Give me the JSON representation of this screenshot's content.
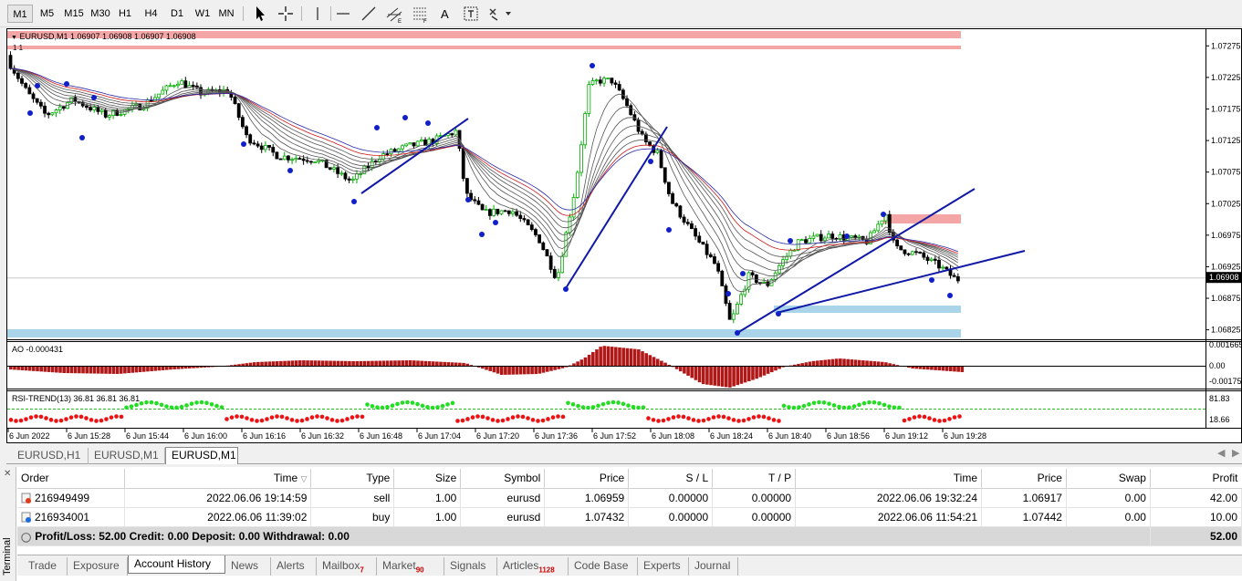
{
  "toolbar": {
    "timeframes": [
      "M1",
      "M5",
      "M15",
      "M30",
      "H1",
      "H4",
      "D1",
      "W1",
      "MN"
    ],
    "selected_timeframe": "M1",
    "tools": [
      "cursor-icon",
      "crosshair-icon",
      "vertical-line-icon",
      "horizontal-line-icon",
      "trend-line-icon",
      "equidistant-channel-icon",
      "fibonacci-icon",
      "text-icon",
      "text-label-icon",
      "shapes-icon"
    ],
    "text_tool_label": "A"
  },
  "chart": {
    "symbol_header": "EURUSD,M1  1.06907 1.06908 1.06907 1.06908",
    "sub_marker": "1   1",
    "price_ticks": [
      "1.07275",
      "1.07225",
      "1.07175",
      "1.07125",
      "1.07075",
      "1.07025",
      "1.06975",
      "1.06925",
      "1.06875",
      "1.06825"
    ],
    "current_price": "1.06908",
    "ao_label": "AO -0.000431",
    "ao_ticks": [
      "0.001665",
      "0.00",
      "-0.00175"
    ],
    "rsi_label": "RSI-TREND(13) 36.81 36.81 36.81",
    "rsi_ticks": [
      "81.83",
      "18.66"
    ],
    "time_ticks": [
      "6 Jun 2022",
      "6 Jun 15:28",
      "6 Jun 15:44",
      "6 Jun 16:00",
      "6 Jun 16:16",
      "6 Jun 16:32",
      "6 Jun 16:48",
      "6 Jun 17:04",
      "6 Jun 17:20",
      "6 Jun 17:36",
      "6 Jun 17:52",
      "6 Jun 18:08",
      "6 Jun 18:24",
      "6 Jun 18:40",
      "6 Jun 18:56",
      "6 Jun 19:12",
      "6 Jun 19:28"
    ],
    "colors": {
      "bull": "#00aa00",
      "bear": "#000000",
      "ao": "#b01818",
      "rsi_up": "#22dd22",
      "rsi_down": "#ee1111",
      "trend": "#1018a8",
      "fractal": "#1020c8",
      "supply": "#f4a6a6",
      "demand": "#a9d4ea"
    }
  },
  "chart_tabs": [
    "EURUSD,H1",
    "EURUSD,M1",
    "EURUSD,M1"
  ],
  "active_chart_tab": 2,
  "terminal": {
    "side_label": "Terminal",
    "columns": [
      "Order",
      "Time",
      "Type",
      "Size",
      "Symbol",
      "Price",
      "S / L",
      "T / P",
      "Time",
      "Price",
      "Swap",
      "Profit"
    ],
    "rows": [
      {
        "order": "216949499",
        "time": "2022.06.06 19:14:59",
        "type": "sell",
        "size": "1.00",
        "symbol": "eurusd",
        "price": "1.06959",
        "sl": "0.00000",
        "tp": "0.00000",
        "close_time": "2022.06.06 19:32:24",
        "close_price": "1.06917",
        "swap": "0.00",
        "profit": "42.00"
      },
      {
        "order": "216934001",
        "time": "2022.06.06 11:39:02",
        "type": "buy",
        "size": "1.00",
        "symbol": "eurusd",
        "price": "1.07432",
        "sl": "0.00000",
        "tp": "0.00000",
        "close_time": "2022.06.06 11:54:21",
        "close_price": "1.07442",
        "swap": "0.00",
        "profit": "10.00"
      }
    ],
    "summary": "Profit/Loss: 52.00  Credit: 0.00  Deposit: 0.00  Withdrawal: 0.00",
    "summary_total": "52.00",
    "tabs": [
      {
        "label": "Trade",
        "badge": ""
      },
      {
        "label": "Exposure",
        "badge": ""
      },
      {
        "label": "Account History",
        "badge": ""
      },
      {
        "label": "News",
        "badge": ""
      },
      {
        "label": "Alerts",
        "badge": ""
      },
      {
        "label": "Mailbox",
        "badge": "7"
      },
      {
        "label": "Market",
        "badge": "90"
      },
      {
        "label": "Signals",
        "badge": ""
      },
      {
        "label": "Articles",
        "badge": "1128"
      },
      {
        "label": "Code Base",
        "badge": ""
      },
      {
        "label": "Experts",
        "badge": ""
      },
      {
        "label": "Journal",
        "badge": ""
      }
    ],
    "active_tab": 2
  }
}
